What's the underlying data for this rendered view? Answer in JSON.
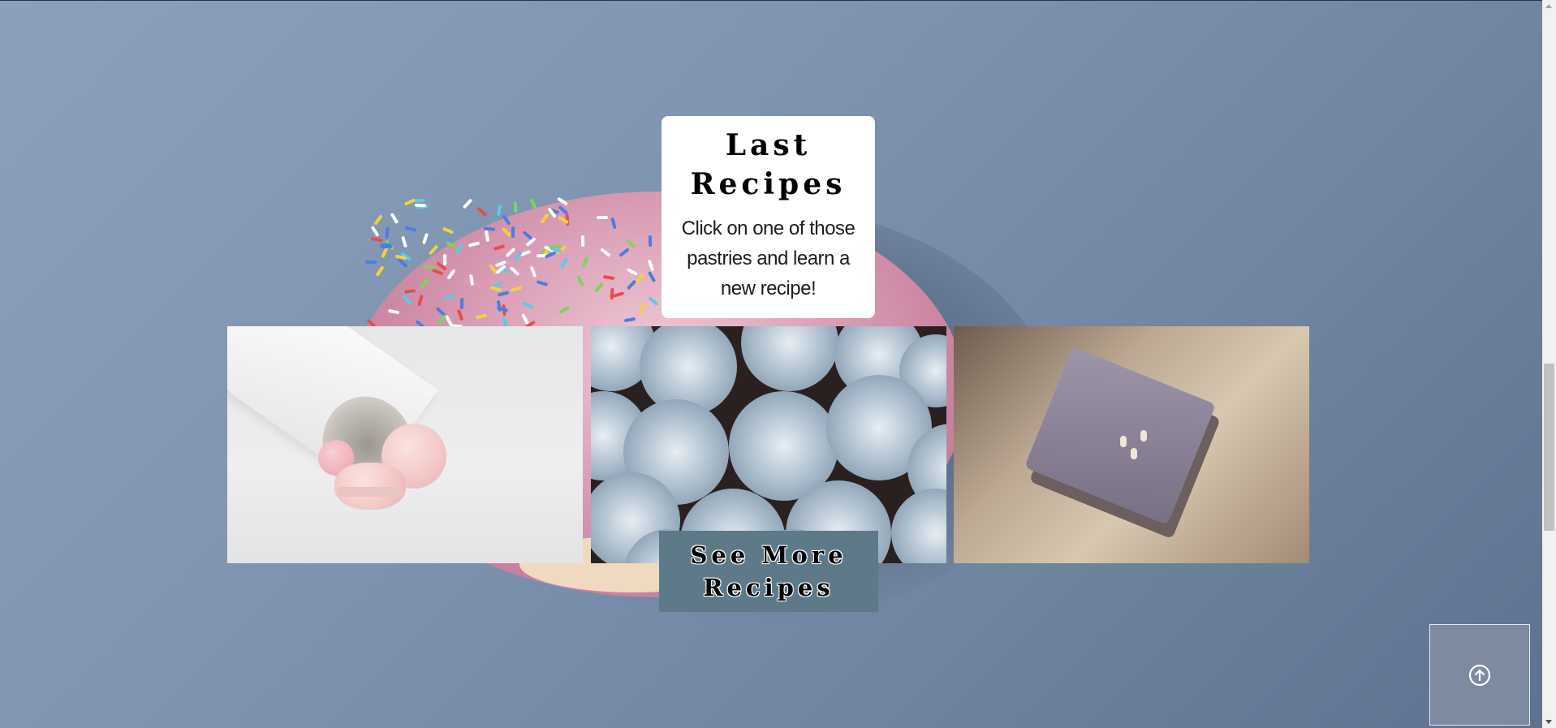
{
  "recipes_section": {
    "title": "Last Recipes",
    "subtitle": "Click on one of those pastries and learn a new recipe!",
    "gallery": [
      {
        "name": "macarons-image",
        "alt": "Macarons"
      },
      {
        "name": "cupcakes-image",
        "alt": "Cupcakes"
      },
      {
        "name": "pastry-bar-image",
        "alt": "Pastry bar"
      }
    ],
    "see_more_label": "See More Recipes"
  },
  "back_to_top": {
    "icon": "arrow-up-circle-icon"
  },
  "colors": {
    "background": "#7f95b1",
    "button": "#5e7a89",
    "back_to_top": "#7d8aa0"
  }
}
